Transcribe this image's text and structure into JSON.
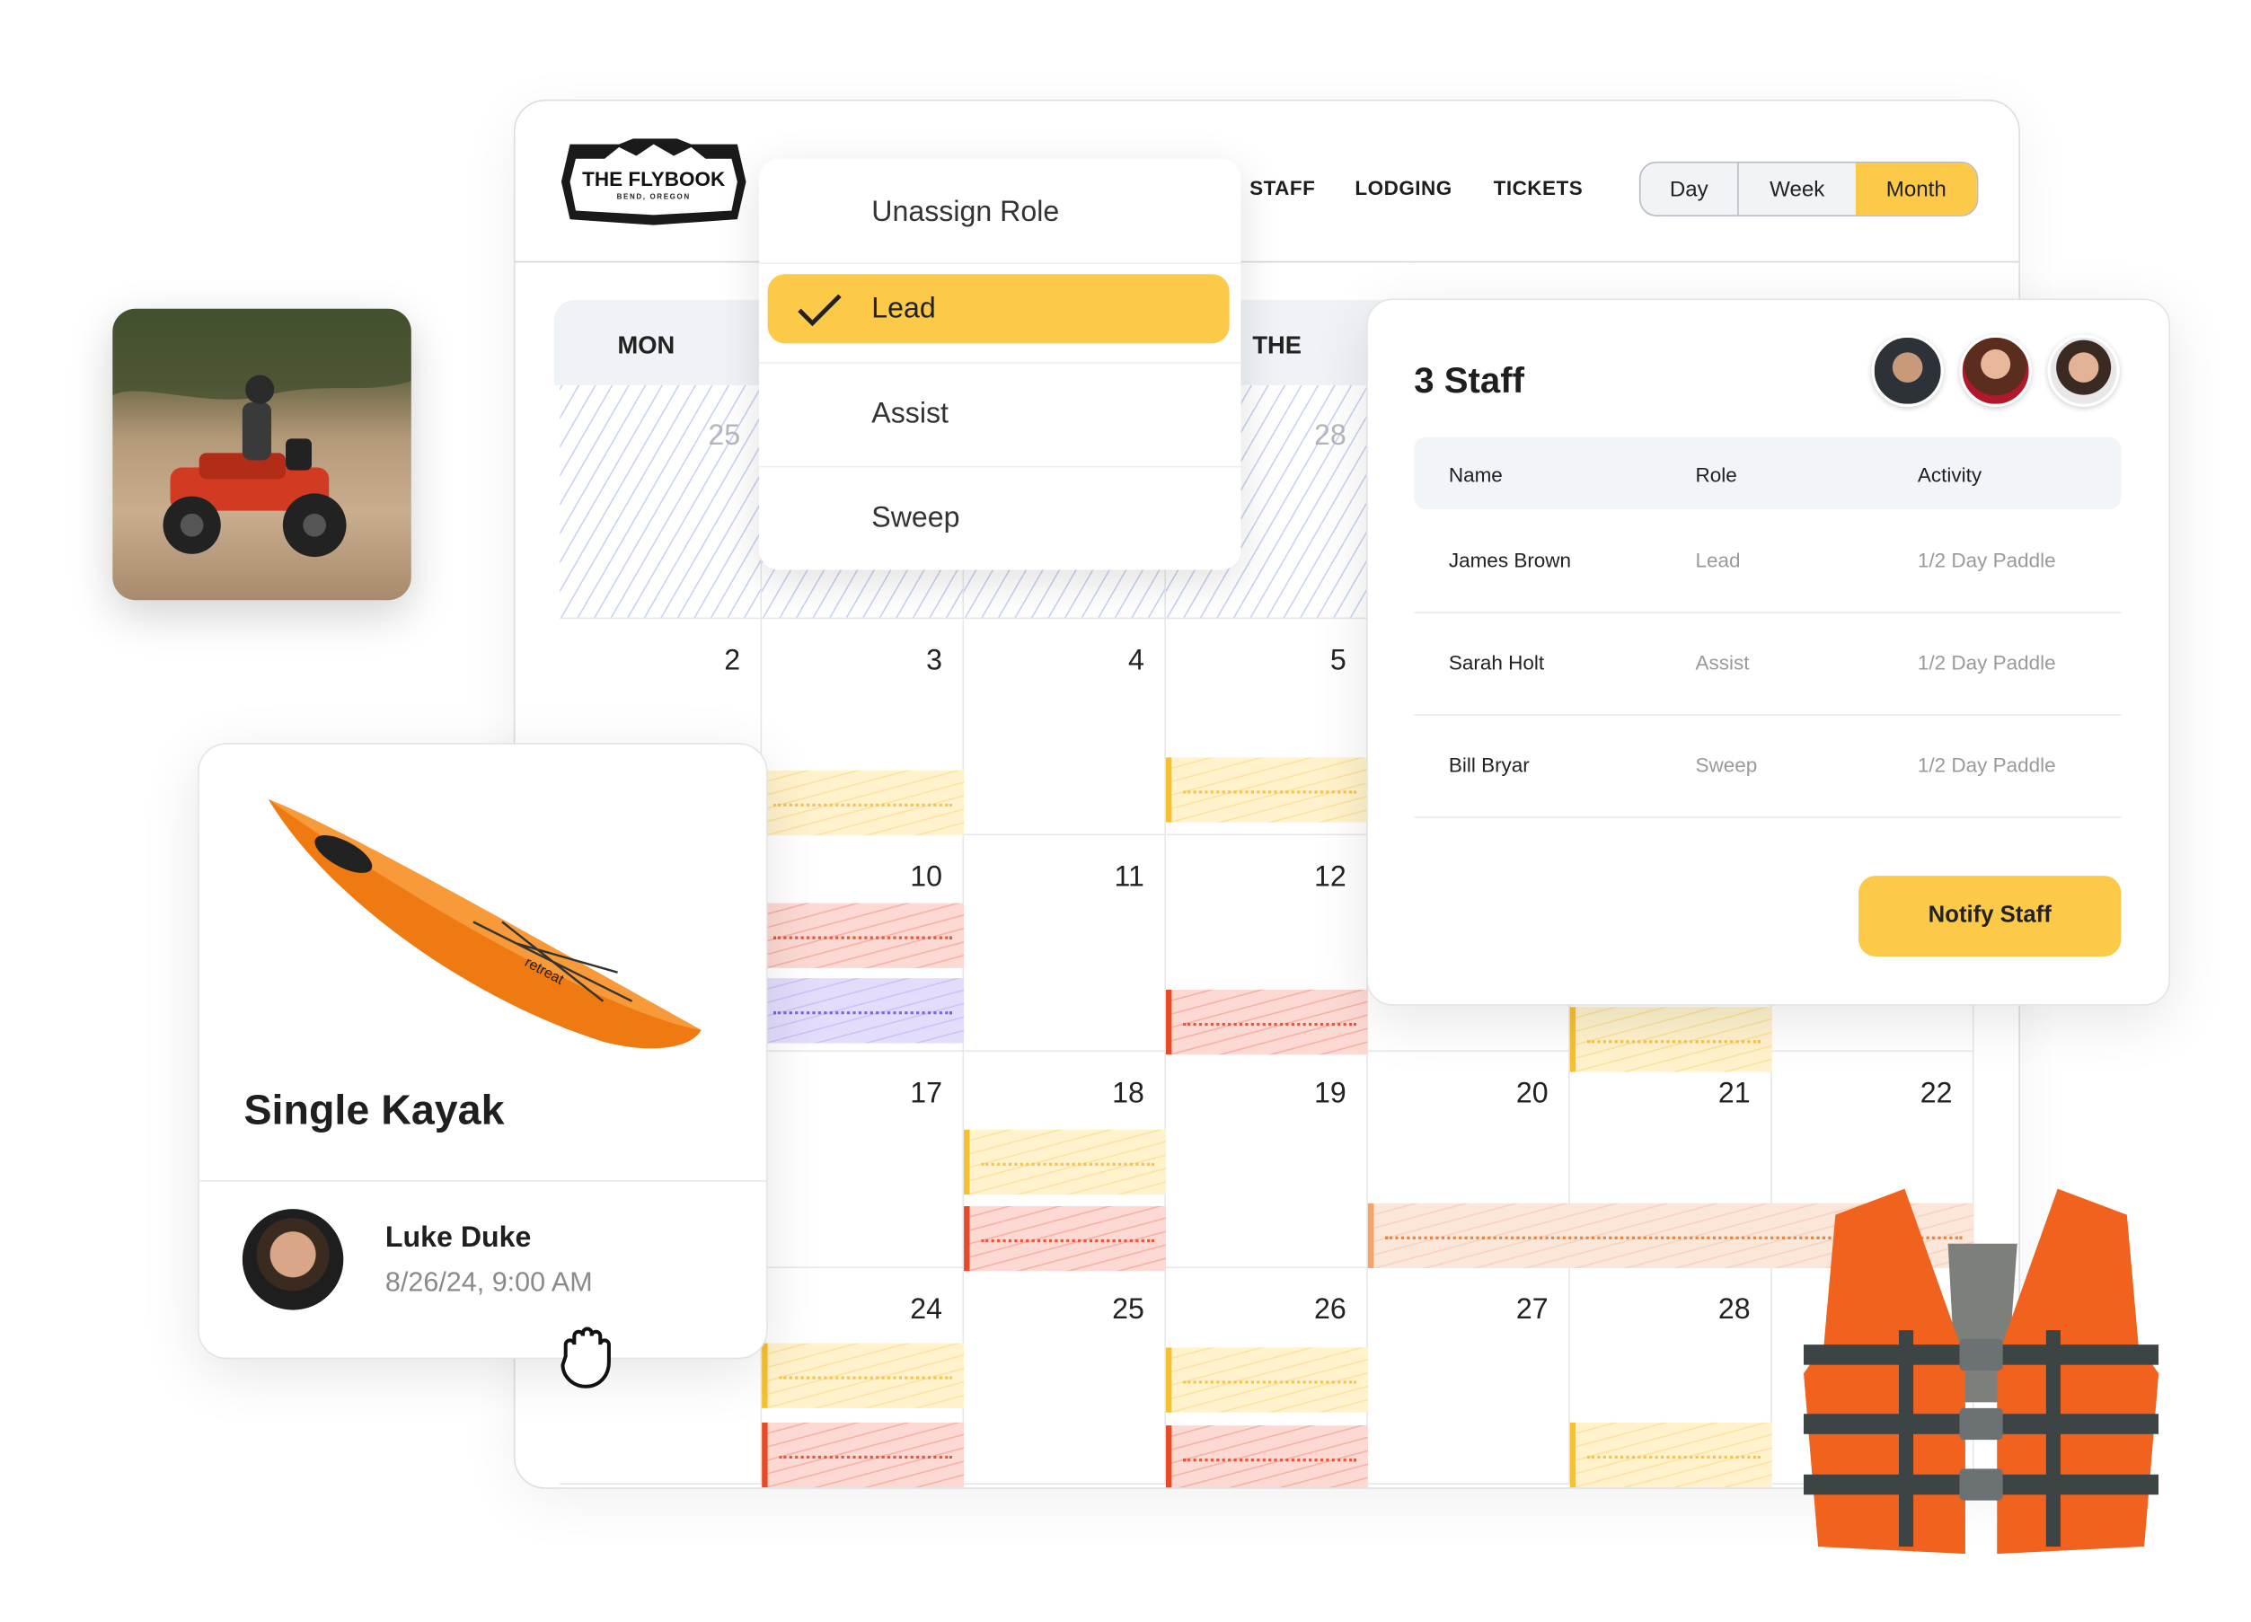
{
  "brand": {
    "logo_text": "THE FLYBOOK",
    "logo_sub": "BEND, OREGON"
  },
  "nav": {
    "items": [
      "STAFF",
      "LODGING",
      "TICKETS"
    ]
  },
  "view_toggle": {
    "options": [
      "Day",
      "Week",
      "Month"
    ],
    "selected": "Month"
  },
  "calendar": {
    "day_headers": [
      "MON",
      "THE"
    ],
    "rows": [
      [
        "25",
        "28"
      ],
      [
        "2",
        "3",
        "4",
        "5"
      ],
      [
        "10",
        "11",
        "12"
      ],
      [
        "17",
        "18",
        "19",
        "20",
        "21",
        "22"
      ],
      [
        "24",
        "25",
        "26",
        "27",
        "28"
      ]
    ]
  },
  "role_menu": {
    "items": [
      "Unassign Role",
      "Lead",
      "Assist",
      "Sweep"
    ],
    "selected": "Lead"
  },
  "staff_panel": {
    "title": "3 Staff",
    "columns": [
      "Name",
      "Role",
      "Activity"
    ],
    "rows": [
      {
        "name": "James Brown",
        "role": "Lead",
        "activity": "1/2 Day Paddle"
      },
      {
        "name": "Sarah Holt",
        "role": "Assist",
        "activity": "1/2 Day Paddle"
      },
      {
        "name": "Bill Bryar",
        "role": "Sweep",
        "activity": "1/2 Day Paddle"
      }
    ],
    "button": "Notify Staff"
  },
  "rental_card": {
    "item": "Single Kayak",
    "kayak_brand": "retreat",
    "user": "Luke Duke",
    "datetime": "8/26/24, 9:00 AM"
  },
  "colors": {
    "accent": "#FCC948",
    "event_yellow": "#F7C02E",
    "event_red": "#E84A27",
    "event_purple": "#7B68D8",
    "event_orange": "#F2822E"
  }
}
